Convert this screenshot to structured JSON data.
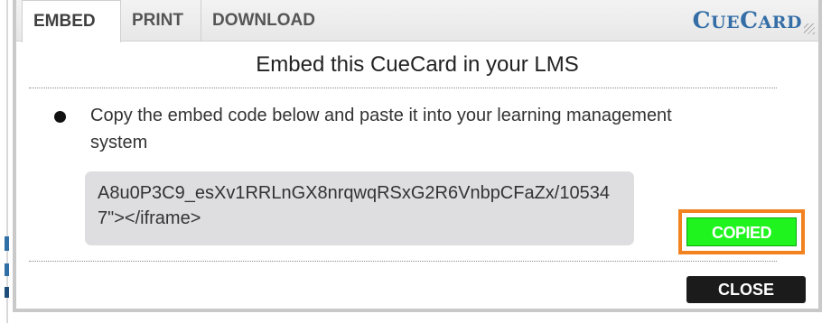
{
  "tabs": [
    {
      "label": "EMBED",
      "active": true
    },
    {
      "label": "PRINT",
      "active": false
    },
    {
      "label": "DOWNLOAD",
      "active": false
    }
  ],
  "logo": {
    "part1_initial": "C",
    "part1_rest": "UE",
    "part2_initial": "C",
    "part2_rest": "ARD"
  },
  "heading": "Embed this CueCard in your LMS",
  "instruction": "Copy the embed code below and paste it into your learning management system",
  "embed_code": "A8u0P3C9_esXv1RRLnGX8nrqwqRSxG2R6VnbpCFaZx/105347\"></iframe>",
  "buttons": {
    "copied": "COPIED",
    "close": "CLOSE"
  },
  "colors": {
    "logo_blue": "#356ea6",
    "copied_green": "#1ff41f",
    "highlight_orange": "#f1821f",
    "close_dark": "#1b1b1b",
    "code_box_gray": "#dedee1"
  }
}
